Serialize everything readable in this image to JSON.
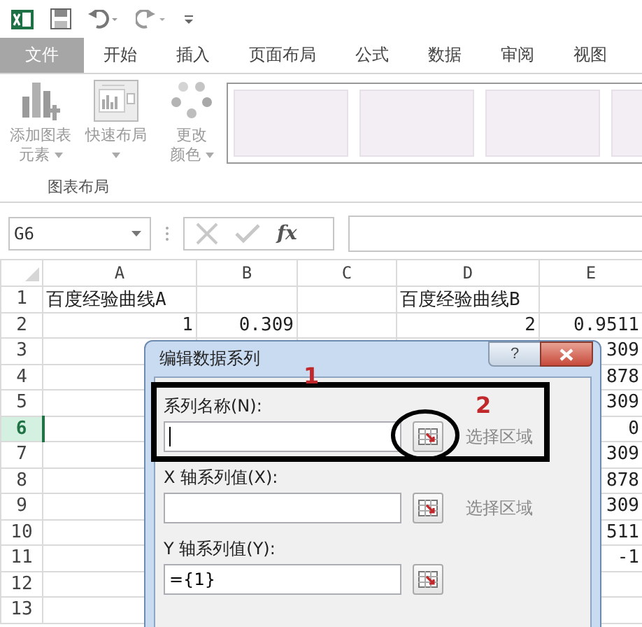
{
  "tabs": [
    {
      "label": "文件",
      "kind": "file"
    },
    {
      "label": "开始",
      "kind": "tab"
    },
    {
      "label": "插入",
      "kind": "tab"
    },
    {
      "label": "页面布局",
      "kind": "tab"
    },
    {
      "label": "公式",
      "kind": "tab"
    },
    {
      "label": "数据",
      "kind": "tab"
    },
    {
      "label": "审阅",
      "kind": "tab"
    },
    {
      "label": "视图",
      "kind": "tab"
    }
  ],
  "ribbon": {
    "groups": [
      {
        "label": "图表布局",
        "buttons": [
          {
            "label": "添加图表元素",
            "kind": "add-element",
            "disabled": true
          },
          {
            "label": "快速布局",
            "kind": "quick-layout",
            "disabled": true
          }
        ]
      },
      {
        "buttons": [
          {
            "label": "更改颜色",
            "kind": "colors",
            "disabled": true
          }
        ]
      }
    ],
    "chart_styles": [
      {
        "kind": "blank"
      },
      {
        "kind": "blank"
      },
      {
        "kind": "blank"
      },
      {
        "kind": "blank"
      }
    ]
  },
  "formula_bar": {
    "name_box": "G6",
    "function_label": "fx"
  },
  "sheet": {
    "columns": [
      "A",
      "B",
      "C",
      "D",
      "E"
    ],
    "rows": [
      {
        "number": "1",
        "selected": false,
        "kind": "text",
        "cells": [
          "百度经验曲线A",
          "",
          "",
          "百度经验曲线B",
          ""
        ]
      },
      {
        "number": "2",
        "selected": false,
        "kind": "number",
        "cells": [
          "1",
          "0.309",
          "",
          "2",
          "0.9511"
        ]
      },
      {
        "number": "3",
        "selected": false,
        "kind": "number",
        "cells": [
          "",
          "",
          "",
          "",
          "309"
        ]
      },
      {
        "number": "4",
        "selected": false,
        "kind": "number",
        "cells": [
          "",
          "",
          "",
          "",
          "878"
        ]
      },
      {
        "number": "5",
        "selected": false,
        "kind": "number",
        "cells": [
          "",
          "",
          "",
          "",
          "309"
        ]
      },
      {
        "number": "6",
        "selected": true,
        "kind": "number",
        "cells": [
          "",
          "",
          "",
          "",
          "0"
        ]
      },
      {
        "number": "7",
        "selected": false,
        "kind": "number",
        "cells": [
          "",
          "",
          "",
          "",
          "309"
        ]
      },
      {
        "number": "8",
        "selected": false,
        "kind": "number",
        "cells": [
          "",
          "",
          "",
          "",
          "878"
        ]
      },
      {
        "number": "9",
        "selected": false,
        "kind": "number",
        "cells": [
          "",
          "",
          "",
          "",
          "309"
        ]
      },
      {
        "number": "10",
        "selected": false,
        "kind": "number",
        "cells": [
          "",
          "",
          "",
          "",
          "511"
        ]
      },
      {
        "number": "11",
        "selected": false,
        "kind": "number",
        "cells": [
          "",
          "",
          "",
          "",
          "-1"
        ]
      },
      {
        "number": "12",
        "selected": false,
        "kind": "number",
        "cells": [
          "",
          "",
          "",
          "",
          ""
        ]
      },
      {
        "number": "13",
        "selected": false,
        "kind": "number",
        "cells": [
          "",
          "",
          "",
          "",
          ""
        ]
      }
    ]
  },
  "dialog": {
    "title": "编辑数据系列",
    "help": "?",
    "fields": [
      {
        "label": "系列名称(N):",
        "focused": true,
        "action_label": "选择区域"
      },
      {
        "label": "X 轴系列值(X):",
        "focused": false,
        "action_label": "选择区域"
      },
      {
        "label": "Y 轴系列值(Y):",
        "value": "={1}",
        "focused": false
      }
    ]
  },
  "annotations": [
    {
      "kind": "box"
    },
    {
      "kind": "circle"
    },
    {
      "kind": "number",
      "text": "1"
    },
    {
      "kind": "number",
      "text": "2"
    }
  ]
}
